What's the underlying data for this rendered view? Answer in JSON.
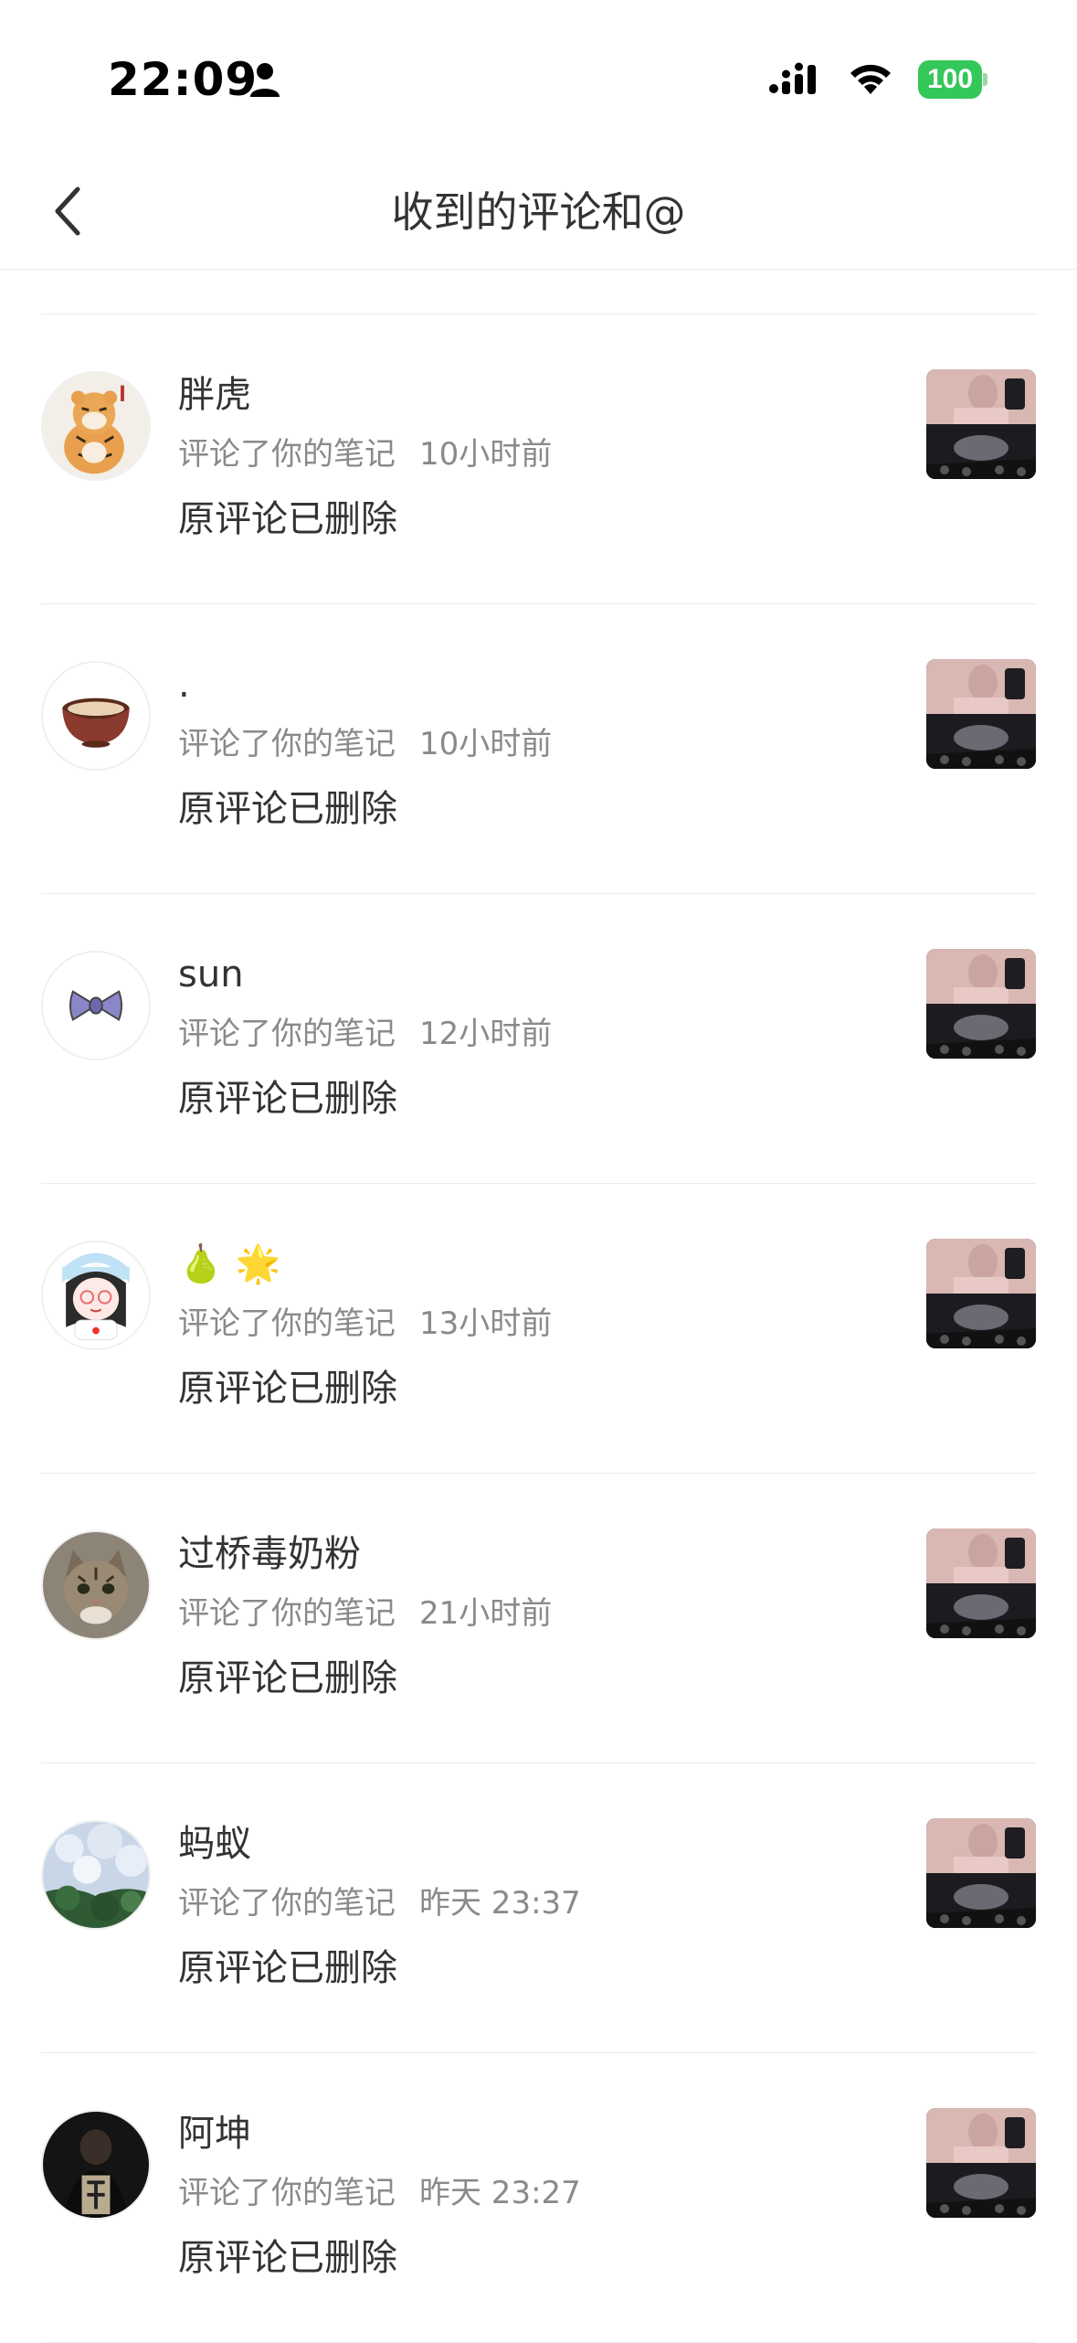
{
  "status_bar": {
    "time": "22:09",
    "battery": "100"
  },
  "header": {
    "title": "收到的评论和@"
  },
  "items": [
    {
      "name": "胖虎",
      "action": "评论了你的笔记",
      "time": "10小时前",
      "comment": "原评论已删除",
      "avatar": "tiger-avatar"
    },
    {
      "name": ".",
      "action": "评论了你的笔记",
      "time": "10小时前",
      "comment": "原评论已删除",
      "avatar": "bowl-avatar"
    },
    {
      "name": "sun",
      "action": "评论了你的笔记",
      "time": "12小时前",
      "comment": "原评论已删除",
      "avatar": "bow-avatar"
    },
    {
      "name": "🍐 🌟",
      "action": "评论了你的笔记",
      "time": "13小时前",
      "comment": "原评论已删除",
      "avatar": "cartoon-girl-avatar"
    },
    {
      "name": "过桥毒奶粉",
      "action": "评论了你的笔记",
      "time": "21小时前",
      "comment": "原评论已删除",
      "avatar": "cat-avatar"
    },
    {
      "name": "蚂蚁",
      "action": "评论了你的笔记",
      "time": "昨天 23:37",
      "comment": "原评论已删除",
      "avatar": "snow-tree-avatar"
    },
    {
      "name": "阿坤",
      "action": "评论了你的笔记",
      "time": "昨天 23:27",
      "comment": "原评论已删除",
      "avatar": "dark-photo-avatar"
    }
  ]
}
